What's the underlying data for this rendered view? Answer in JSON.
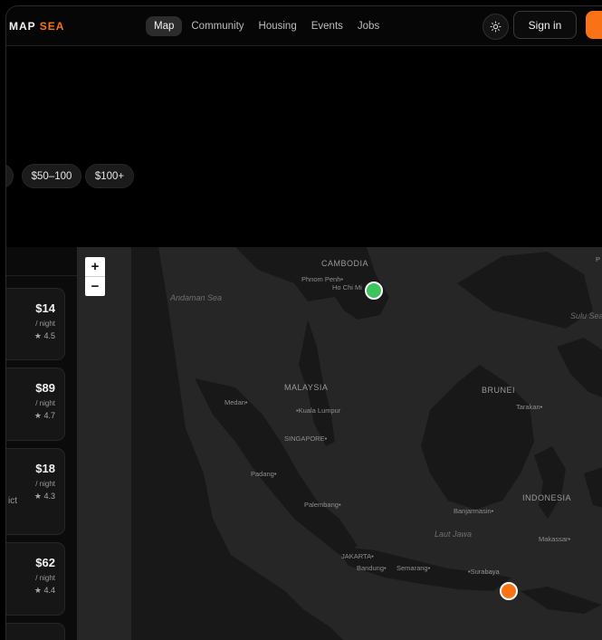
{
  "header": {
    "logo_main": "MAP",
    "logo_accent": "SEA",
    "nav": [
      {
        "label": "Map",
        "active": true
      },
      {
        "label": "Community",
        "active": false
      },
      {
        "label": "Housing",
        "active": false
      },
      {
        "label": "Events",
        "active": false
      },
      {
        "label": "Jobs",
        "active": false
      }
    ],
    "theme_icon": "sun-icon",
    "signin_label": "Sign in",
    "accent_color": "#f97316"
  },
  "filters": {
    "chips": [
      {
        "label": ""
      },
      {
        "label": "$50–100"
      },
      {
        "label": "$100+"
      }
    ]
  },
  "listings": [
    {
      "price": "$14",
      "per": "/ night",
      "rating": "★ 4.5",
      "snippet": ""
    },
    {
      "price": "$89",
      "per": "/ night",
      "rating": "★ 4.7",
      "snippet": ""
    },
    {
      "price": "$18",
      "per": "/ night",
      "rating": "★ 4.3",
      "snippet": "ict"
    },
    {
      "price": "$62",
      "per": "/ night",
      "rating": "★ 4.4",
      "snippet": ""
    }
  ],
  "map": {
    "zoom_in": "+",
    "zoom_out": "−",
    "labels": {
      "cambodia": "CAMBODIA",
      "phnom_penh": "Phnom Penh•",
      "ho_chi_minh": "Ho Chi Mi",
      "andaman_sea": "Andaman Sea",
      "sulu_sea": "Sulu Sea",
      "malaysia": "MALAYSIA",
      "kuala_lumpur": "•Kuala Lumpur",
      "medan": "Medan•",
      "singapore": "SINGAPORE•",
      "brunei": "BRUNEI",
      "tarakan": "Tarakan•",
      "padang": "Padang•",
      "palembang": "Palembang•",
      "banjarmasin": "Banjarmasin•",
      "indonesia": "INDONESIA",
      "laut_jawa": "Laut Jawa",
      "makassar": "Makassar•",
      "jakarta": "JAKARTA•",
      "bandung": "Bandung•",
      "semarang": "Semarang•",
      "surabaya": "•Surabaya",
      "edge_p": "P"
    },
    "markers": [
      {
        "name": "green-marker",
        "color": "#3cc55c"
      },
      {
        "name": "orange-marker",
        "color": "#f97316"
      }
    ]
  }
}
